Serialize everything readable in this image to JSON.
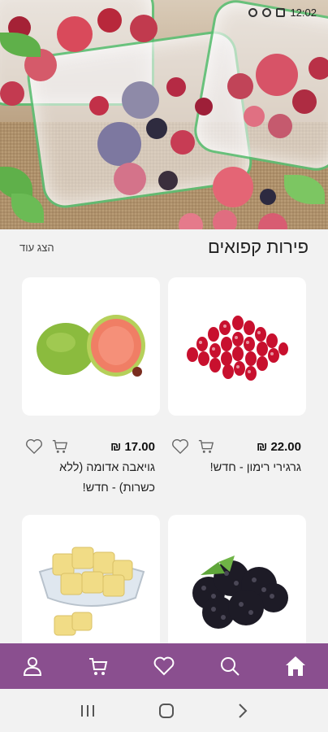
{
  "status_bar": {
    "time": "12:02"
  },
  "section": {
    "title": "פירות קפואים",
    "show_more": "הצג עוד"
  },
  "products": [
    {
      "name": "גרגירי רימון - חדש!",
      "price": "₪ 22.00"
    },
    {
      "name": "גויאבה אדומה (ללא כשרות) - חדש!",
      "price": "₪ 17.00"
    },
    {
      "name": "",
      "price": ""
    },
    {
      "name": "",
      "price": ""
    }
  ],
  "bottom_nav": {
    "items": [
      "home-icon",
      "search-icon",
      "heart-icon",
      "cart-icon",
      "user-icon"
    ]
  },
  "colors": {
    "nav_bg": "#8a4f8f",
    "card_bg": "#ffffff",
    "page_bg": "#f2f2f2"
  }
}
